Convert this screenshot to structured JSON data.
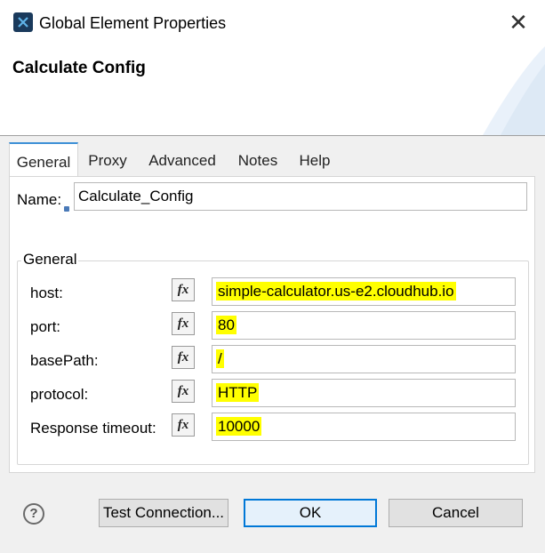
{
  "window": {
    "title": "Global Element Properties",
    "close_glyph": "✕"
  },
  "header": {
    "title": "Calculate Config"
  },
  "tabs": [
    {
      "label": "General",
      "active": true
    },
    {
      "label": "Proxy",
      "active": false
    },
    {
      "label": "Advanced",
      "active": false
    },
    {
      "label": "Notes",
      "active": false
    },
    {
      "label": "Help",
      "active": false
    }
  ],
  "name": {
    "label": "Name:",
    "value": "Calculate_Config"
  },
  "general_group": {
    "title": "General",
    "fx_label": "fx",
    "fields": [
      {
        "label": "host:",
        "value": "simple-calculator.us-e2.cloudhub.io",
        "highlighted": true
      },
      {
        "label": "port:",
        "value": "80",
        "highlighted": true
      },
      {
        "label": "basePath:",
        "value": "/",
        "highlighted": true
      },
      {
        "label": "protocol:",
        "value": "HTTP",
        "highlighted": true
      },
      {
        "label": "Response timeout:",
        "value": "10000",
        "highlighted": true
      }
    ]
  },
  "footer": {
    "help_glyph": "?",
    "test_connection": "Test Connection...",
    "ok": "OK",
    "cancel": "Cancel"
  },
  "colors": {
    "highlight": "#ffff00",
    "tab_accent": "#3c8fd6",
    "ok_border": "#0078d7"
  }
}
